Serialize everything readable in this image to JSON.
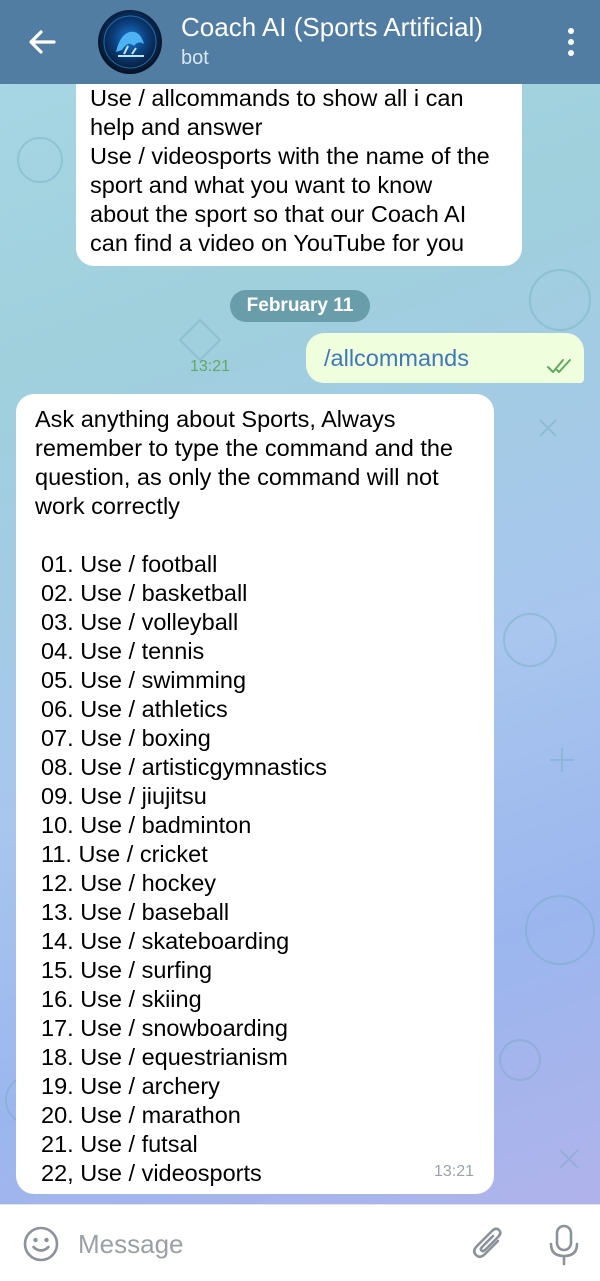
{
  "header": {
    "title": "Coach AI (Sports Artificial)",
    "subtitle": "bot"
  },
  "chat": {
    "message1_lines": [
      "Use / allcommands to show all i can",
      "help and answer",
      "Use / videosports with the name of the",
      "sport and what you want to know",
      "about the sport so that our Coach AI",
      "can find a video on YouTube for you"
    ],
    "date_separator": "February 11",
    "outgoing": {
      "text": "/allcommands",
      "time": "13:21"
    },
    "reply": {
      "intro": "Ask anything about Sports, Always\nremember to type the command and the\nquestion, as only the command will not\nwork correctly",
      "commands": [
        "01. Use / football",
        "02. Use / basketball",
        "03. Use / volleyball",
        "04. Use / tennis",
        "05. Use / swimming",
        "06. Use / athletics",
        "07. Use / boxing",
        "08. Use / artisticgymnastics",
        "09. Use / jiujitsu",
        "10. Use / badminton",
        "11. Use / cricket",
        "12. Use / hockey",
        "13. Use / baseball",
        "14. Use / skateboarding",
        "15. Use / surfing",
        "16. Use / skiing",
        "17. Use / snowboarding",
        "18. Use / equestrianism",
        "19. Use / archery",
        "20. Use / marathon",
        "21. Use / futsal",
        "22, Use / videosports"
      ],
      "time": "13:21"
    }
  },
  "composer": {
    "placeholder": "Message"
  },
  "icons": {
    "back": "arrow-left-icon",
    "menu": "more-vertical-icon",
    "emoji": "smile-icon",
    "attach": "paperclip-icon",
    "mic": "microphone-icon",
    "read": "double-check-icon"
  },
  "colors": {
    "header_bg": "#517da2",
    "outgoing_bubble": "#effedd",
    "outgoing_text": "#3f78b6",
    "check": "#62a862"
  }
}
